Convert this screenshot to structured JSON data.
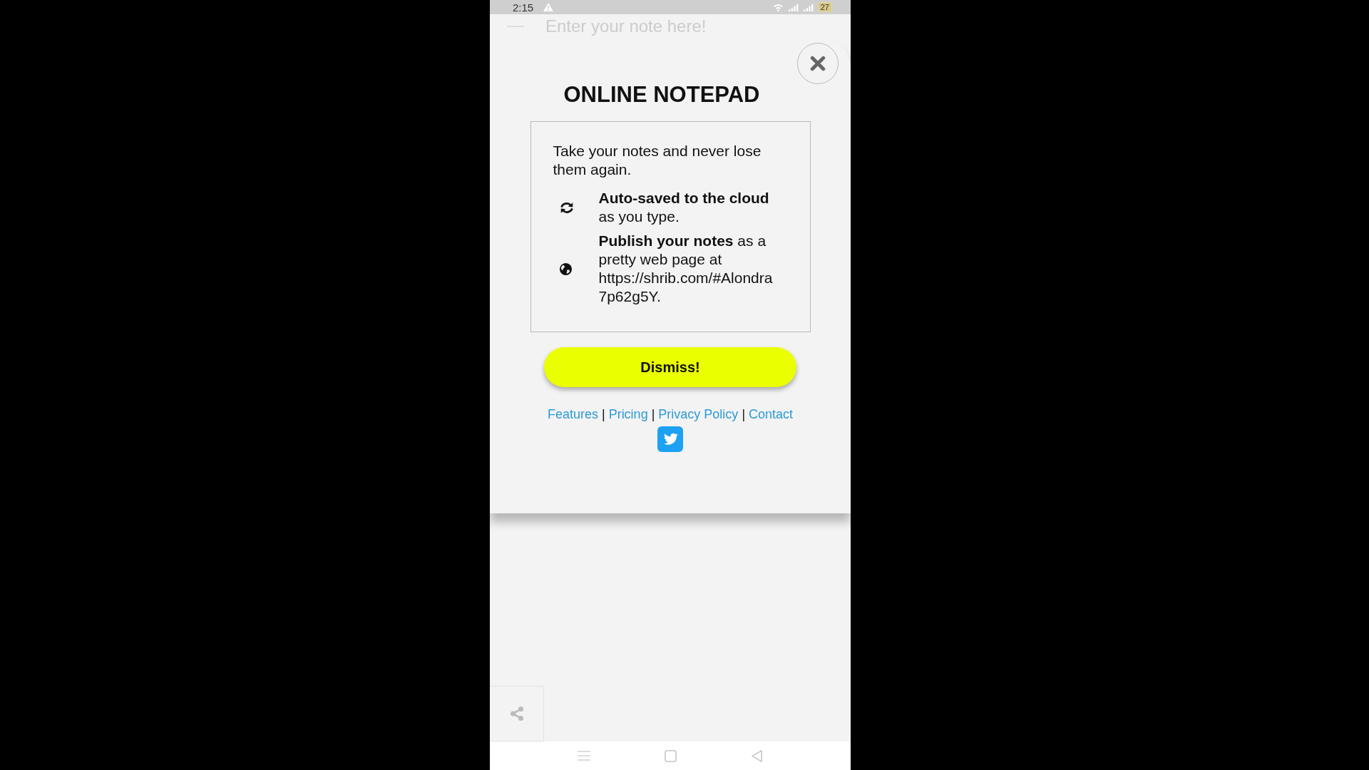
{
  "status_bar": {
    "time": "2:15",
    "battery": "27"
  },
  "editor": {
    "placeholder": "Enter your note here!"
  },
  "dialog": {
    "title": "ONLINE NOTEPAD",
    "intro": "Take your notes and never lose them again.",
    "features": [
      {
        "kind": "sync",
        "text": "**Auto-saved to the cloud** as you type."
      },
      {
        "kind": "globe",
        "text": "**Publish your notes** as a pretty web page at https://shrib.com/#Alondra7p62g5Y."
      }
    ],
    "button": "Dismiss!",
    "links": [
      "Features",
      "Pricing",
      "Privacy Policy",
      "Contact"
    ],
    "separators": [
      "|",
      "|",
      "|"
    ]
  }
}
